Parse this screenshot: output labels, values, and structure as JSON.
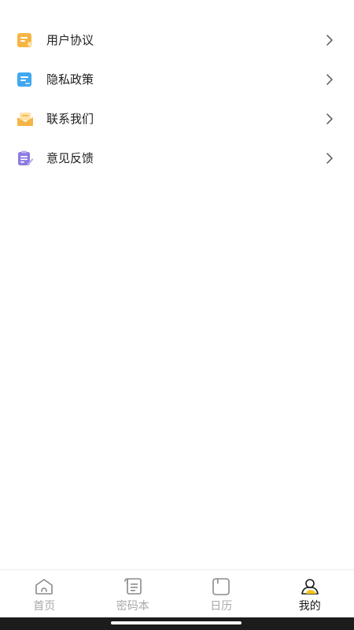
{
  "menu": {
    "items": [
      {
        "label": "用户协议",
        "icon": "document-icon",
        "color": "#F5B545"
      },
      {
        "label": "隐私政策",
        "icon": "privacy-doc-icon",
        "color": "#3FA8F0"
      },
      {
        "label": "联系我们",
        "icon": "mail-icon",
        "color": "#F5B545"
      },
      {
        "label": "意见反馈",
        "icon": "feedback-icon",
        "color": "#8C7BE0"
      }
    ]
  },
  "tabbar": {
    "tabs": [
      {
        "label": "首页",
        "icon": "home-icon",
        "active": false
      },
      {
        "label": "密码本",
        "icon": "notebook-icon",
        "active": false
      },
      {
        "label": "日历",
        "icon": "calendar-icon",
        "active": false
      },
      {
        "label": "我的",
        "icon": "profile-icon",
        "active": true
      }
    ],
    "accent": "#F5C518"
  }
}
